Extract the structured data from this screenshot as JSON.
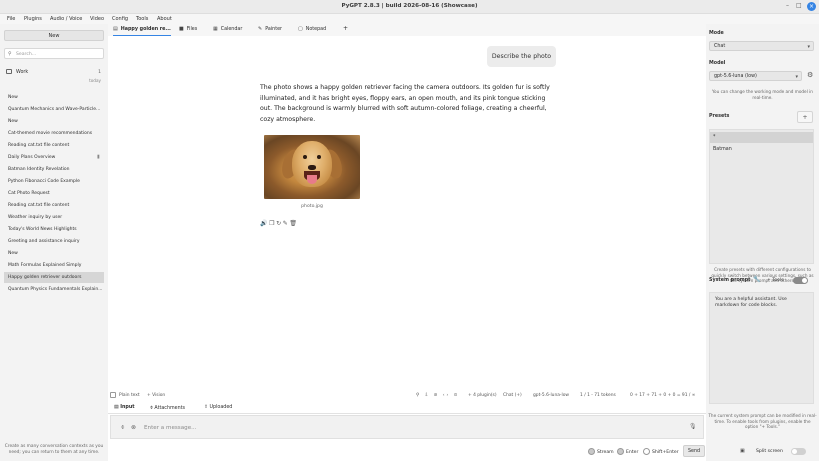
{
  "window": {
    "title": "PyGPT 2.8.3 | build 2026-08-16 (Showcase)",
    "minimize": "–",
    "maximize": "□",
    "close": "×"
  },
  "menu": [
    "File",
    "Plugins",
    "Audio / Voice",
    "Video",
    "Config",
    "Tools",
    "About"
  ],
  "left": {
    "new_button": "New",
    "search_placeholder": "Search...",
    "folder": {
      "label": "Work",
      "count": "1",
      "date": "today"
    },
    "conversations": [
      "New",
      "Quantum Mechanics and Wave-Particle...",
      "New",
      "Cat-themed movie recommendations",
      "Reading cat.txt file content",
      "Daily Plans Overview",
      "Batman Identity Revelation",
      "Python Fibonacci Code Example",
      "Cat Photo Request",
      "Reading cat.txt file content",
      "Weather inquiry by user",
      "Today's World News Highlights",
      "Greeting and assistance inquiry",
      "New",
      "Math Formulas Explained Simply",
      "Happy golden retriever outdoors",
      "Quantum Physics Fundamentals Explain..."
    ],
    "hint": "Create as many conversation contexts as you need; you can return to them at any time."
  },
  "tabs": [
    "Happy golden re...",
    "Files",
    "Calendar",
    "Painter",
    "Notepad",
    "+"
  ],
  "chat": {
    "user_message": "Describe the photo",
    "assistant_message": "The photo shows a happy golden retriever facing the camera outdoors. Its golden fur is softly illuminated, and it has bright eyes, floppy ears, an open mouth, and its pink tongue sticking out. The background is warmly blurred with soft autumn-colored foliage, creating a cheerful, cozy atmosphere.",
    "photo_caption": "photo.jpg",
    "actions": [
      "🔊",
      "❐",
      "↻",
      "✎",
      "🗑"
    ]
  },
  "status": {
    "plain_text": "Plain text",
    "vision": "+ Vision",
    "plugins": "+ 4 plugin(s)",
    "mode": "Chat (+)",
    "model": "gpt-5.6-luna-low",
    "tokens": "1 / 1 - 71 tokens",
    "token_detail": "0 + 17 + 71 + 0 + 0 = 91 / ∞"
  },
  "input": {
    "tabs": [
      "Input",
      "Attachments",
      "Uploaded"
    ],
    "placeholder": "Enter a message..."
  },
  "bottom": {
    "stream": "Stream",
    "enter": "Enter",
    "shift_enter": "Shift+Enter",
    "send": "Send",
    "split_screen": "Split screen"
  },
  "right": {
    "mode_label": "Mode",
    "mode_value": "Chat",
    "model_label": "Model",
    "model_value": "gpt-5.6-luna (low)",
    "model_hint": "You can change the working mode and model in real-time.",
    "presets_label": "Presets",
    "presets_add": "+",
    "presets": [
      "*",
      "Batman"
    ],
    "presets_hint": "Create presets with different configurations to quickly switch between various settings, such as the system prompt and others.",
    "system_prompt_label": "System prompt",
    "tools_label": "+ Tools",
    "system_prompt_text": "You are a helpful assistant. Use markdown for code blocks.",
    "system_hint": "The current system prompt can be modified in real-time. To enable tools from plugins, enable the option \"+ Tools.\""
  }
}
